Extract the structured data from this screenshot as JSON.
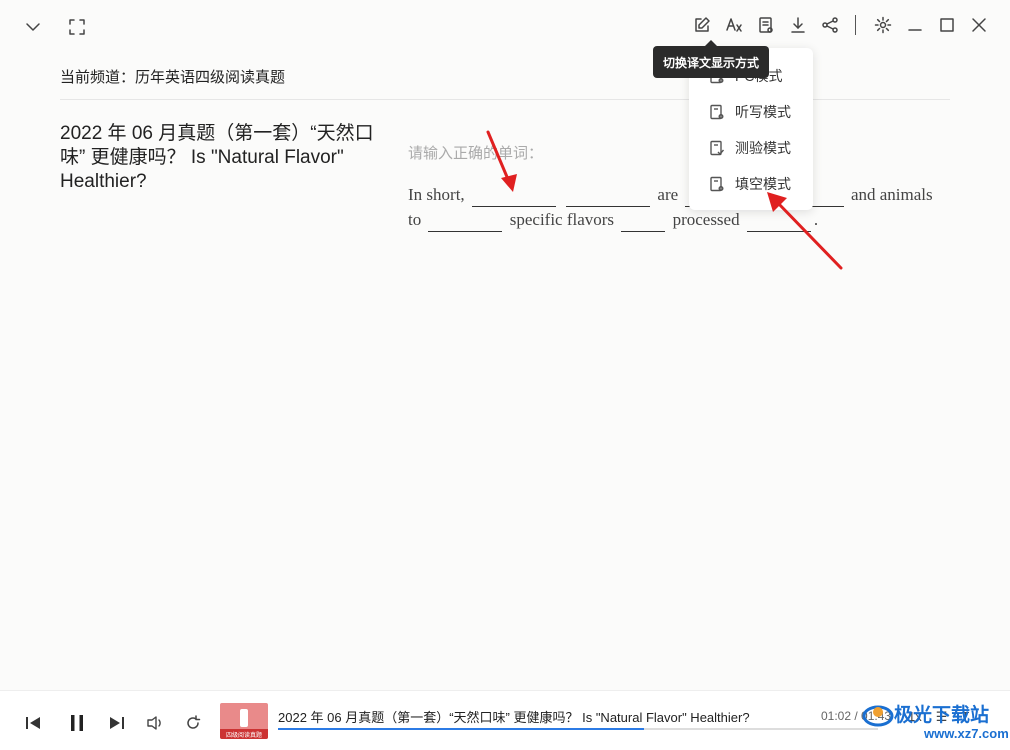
{
  "toolbar": {
    "left_icons": [
      "chevron-down-icon",
      "fullscreen-icon"
    ],
    "right_icons": [
      "edit-icon",
      "translate-icon",
      "mode-icon",
      "download-icon",
      "share-icon",
      "gear-icon",
      "minimize-icon",
      "maximize-icon",
      "close-icon"
    ]
  },
  "tooltip": {
    "text": "切换译文显示方式"
  },
  "dropdown": {
    "items": [
      {
        "label": "PC模式",
        "icon": "doc-icon"
      },
      {
        "label": "听写模式",
        "icon": "doc-icon"
      },
      {
        "label": "测验模式",
        "icon": "doc-check-icon"
      },
      {
        "label": "填空模式",
        "icon": "doc-icon"
      }
    ]
  },
  "channel": {
    "text": "当前频道：历年英语四级阅读真题"
  },
  "article": {
    "title": "2022 年 06 月真题（第一套）“天然口味” 更健康吗？  Is \"Natural Flavor\" Healthier?"
  },
  "exercise": {
    "prompt": "请输入正确的单词：",
    "seg1": "In short,",
    "seg2": "are",
    "seg3": "and",
    "seg4": "animals to",
    "seg5": "specific flavors",
    "seg6": "processed",
    "seg7": "."
  },
  "player": {
    "title": "2022 年 06 月真题（第一套）“天然口味” 更健康吗？  Is \"Natural Flavor\" Healthier?",
    "current_time": "01:02",
    "total_time": "01:43",
    "progress": 0.61,
    "speed": "1x",
    "thumbnail_caption": "四级阅读真题"
  },
  "watermark": {
    "text": "极光下载站",
    "url": "www.xz7.com"
  },
  "colors": {
    "accent": "#2c7be5",
    "arrow": "#e02020"
  }
}
